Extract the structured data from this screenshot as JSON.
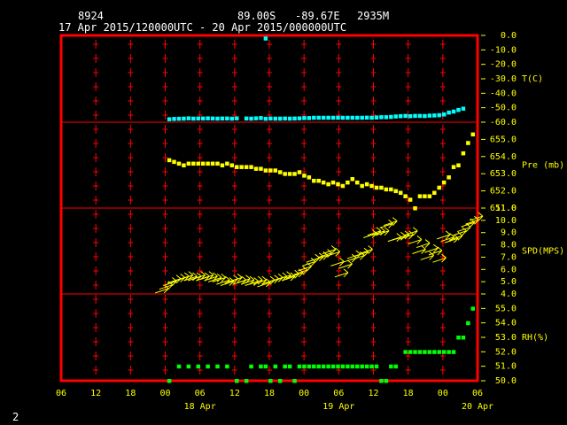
{
  "header": {
    "station": "8924",
    "lat": "89.00S",
    "lon": "-89.67E",
    "elev": "2935M",
    "time_range": "17 Apr 2015/120000UTC - 20 Apr 2015/000000UTC"
  },
  "page_number": "2",
  "colors": {
    "frame": "#ff0000",
    "grid": "#ff0000",
    "temp": "#00ffff",
    "pres": "#ffff00",
    "wind": "#ffff00",
    "rh": "#00ff00",
    "axis_text": "#ffff00",
    "header_text": "#ffffff"
  },
  "chart_data": {
    "type": "scatter",
    "x_axis": {
      "label": "",
      "units": "hours from 17 Apr 2015 06UTC",
      "xlim": [
        0,
        72
      ],
      "tick_hours": [
        0,
        6,
        12,
        18,
        24,
        30,
        36,
        42,
        48,
        54,
        60,
        66,
        72
      ],
      "tick_labels": [
        "06",
        "12",
        "18",
        "00",
        "06",
        "12",
        "18",
        "00",
        "06",
        "12",
        "18",
        "00",
        "06"
      ],
      "date_labels": [
        {
          "hour": 24,
          "text": "18 Apr"
        },
        {
          "hour": 48,
          "text": "19 Apr"
        },
        {
          "hour": 72,
          "text": "20 Apr"
        }
      ]
    },
    "panels": [
      {
        "name": "temp",
        "label": "T(C)",
        "ylim": [
          -60,
          0
        ],
        "ticks": [
          "0.0",
          "-10.0",
          "-20.0",
          "-30.0",
          "-40.0",
          "-50.0",
          "-60.0"
        ],
        "tick_values": [
          0,
          -10,
          -20,
          -30,
          -40,
          -50,
          -60
        ],
        "points": [
          [
            8,
            -57.8
          ],
          [
            9,
            -57.6
          ],
          [
            10,
            -57.5
          ],
          [
            11,
            -57.4
          ],
          [
            12,
            -57.2
          ],
          [
            13,
            -57.4
          ],
          [
            14,
            -57.3
          ],
          [
            15,
            -57.3
          ],
          [
            16,
            -57.2
          ],
          [
            17,
            -57.3
          ],
          [
            18,
            -57.4
          ],
          [
            19,
            -57.3
          ],
          [
            20,
            -57.3
          ],
          [
            21,
            -57.4
          ],
          [
            22,
            -57.2
          ],
          [
            24,
            -57.3
          ],
          [
            25,
            -57.4
          ],
          [
            26,
            -57.2
          ],
          [
            27,
            -57.0
          ],
          [
            28,
            -2.0
          ],
          [
            28,
            -57.5
          ],
          [
            29,
            -57.3
          ],
          [
            30,
            -57.4
          ],
          [
            31,
            -57.4
          ],
          [
            32,
            -57.3
          ],
          [
            33,
            -57.4
          ],
          [
            34,
            -57.3
          ],
          [
            35,
            -57.2
          ],
          [
            36,
            -57.0
          ],
          [
            37,
            -57.0
          ],
          [
            38,
            -56.8
          ],
          [
            39,
            -56.8
          ],
          [
            40,
            -56.8
          ],
          [
            41,
            -56.8
          ],
          [
            42,
            -56.8
          ],
          [
            43,
            -56.8
          ],
          [
            44,
            -56.8
          ],
          [
            45,
            -56.8
          ],
          [
            46,
            -56.8
          ],
          [
            47,
            -56.8
          ],
          [
            48,
            -56.8
          ],
          [
            49,
            -56.7
          ],
          [
            50,
            -56.8
          ],
          [
            51,
            -56.6
          ],
          [
            52,
            -56.4
          ],
          [
            53,
            -56.4
          ],
          [
            54,
            -56.2
          ],
          [
            55,
            -55.9
          ],
          [
            56,
            -55.7
          ],
          [
            57,
            -55.5
          ],
          [
            58,
            -55.7
          ],
          [
            59,
            -55.5
          ],
          [
            60,
            -55.5
          ],
          [
            61,
            -55.6
          ],
          [
            62,
            -55.3
          ],
          [
            63,
            -55.2
          ],
          [
            64,
            -55.0
          ],
          [
            65,
            -54.5
          ],
          [
            66,
            -53.2
          ],
          [
            67,
            -52.5
          ],
          [
            68,
            -51.4
          ],
          [
            69,
            -50.5
          ]
        ]
      },
      {
        "name": "pres",
        "label": "Pre (mb)",
        "ylim": [
          651,
          656
        ],
        "ticks": [
          "655.0",
          "654.0",
          "653.0",
          "652.0",
          "651.0"
        ],
        "tick_values": [
          655,
          654,
          653,
          652,
          651
        ],
        "points": [
          [
            8,
            653.8
          ],
          [
            9,
            653.7
          ],
          [
            10,
            653.6
          ],
          [
            11,
            653.5
          ],
          [
            12,
            653.6
          ],
          [
            13,
            653.6
          ],
          [
            14,
            653.6
          ],
          [
            15,
            653.6
          ],
          [
            16,
            653.6
          ],
          [
            17,
            653.6
          ],
          [
            18,
            653.6
          ],
          [
            19,
            653.5
          ],
          [
            20,
            653.6
          ],
          [
            21,
            653.5
          ],
          [
            22,
            653.4
          ],
          [
            23,
            653.4
          ],
          [
            24,
            653.4
          ],
          [
            25,
            653.4
          ],
          [
            26,
            653.3
          ],
          [
            27,
            653.3
          ],
          [
            28,
            653.2
          ],
          [
            29,
            653.2
          ],
          [
            30,
            653.2
          ],
          [
            31,
            653.1
          ],
          [
            32,
            653.0
          ],
          [
            33,
            653.0
          ],
          [
            34,
            653.0
          ],
          [
            35,
            653.1
          ],
          [
            36,
            652.9
          ],
          [
            37,
            652.8
          ],
          [
            38,
            652.6
          ],
          [
            39,
            652.6
          ],
          [
            40,
            652.5
          ],
          [
            41,
            652.4
          ],
          [
            42,
            652.5
          ],
          [
            43,
            652.4
          ],
          [
            44,
            652.3
          ],
          [
            45,
            652.5
          ],
          [
            46,
            652.7
          ],
          [
            47,
            652.5
          ],
          [
            48,
            652.3
          ],
          [
            49,
            652.4
          ],
          [
            50,
            652.3
          ],
          [
            51,
            652.2
          ],
          [
            52,
            652.2
          ],
          [
            53,
            652.1
          ],
          [
            54,
            652.1
          ],
          [
            55,
            652.0
          ],
          [
            56,
            651.9
          ],
          [
            57,
            651.7
          ],
          [
            58,
            651.5
          ],
          [
            59,
            651.0
          ],
          [
            60,
            651.7
          ],
          [
            61,
            651.7
          ],
          [
            62,
            651.7
          ],
          [
            63,
            651.9
          ],
          [
            64,
            652.2
          ],
          [
            65,
            652.5
          ],
          [
            66,
            652.8
          ],
          [
            67,
            653.4
          ],
          [
            68,
            653.5
          ],
          [
            69,
            654.2
          ],
          [
            70,
            654.8
          ],
          [
            71,
            655.3
          ]
        ]
      },
      {
        "name": "wind",
        "label": "SPD(MPS)",
        "ylim": [
          4,
          11
        ],
        "ticks": [
          "11.0",
          "10.0",
          "9.0",
          "8.0",
          "7.0",
          "6.0",
          "5.0",
          "4.0"
        ],
        "tick_values": [
          11,
          10,
          9,
          8,
          7,
          6,
          5,
          4
        ],
        "points": [
          [
            8,
            4.3
          ],
          [
            9,
            4.6
          ],
          [
            10,
            4.9
          ],
          [
            11,
            5.1
          ],
          [
            12,
            5.2
          ],
          [
            13,
            5.3
          ],
          [
            14,
            5.4
          ],
          [
            15,
            5.3
          ],
          [
            16,
            5.3
          ],
          [
            17,
            5.4
          ],
          [
            18,
            5.3
          ],
          [
            19,
            5.4
          ],
          [
            20,
            5.3
          ],
          [
            21,
            5.2
          ],
          [
            22,
            5.2
          ],
          [
            23,
            5.0
          ],
          [
            24,
            4.9
          ],
          [
            25,
            5.1
          ],
          [
            26,
            5.2
          ],
          [
            27,
            5.0
          ],
          [
            28,
            5.1
          ],
          [
            29,
            5.0
          ],
          [
            30,
            4.9
          ],
          [
            31,
            5.0
          ],
          [
            32,
            5.0
          ],
          [
            33,
            4.8
          ],
          [
            34,
            5.0
          ],
          [
            35,
            5.1
          ],
          [
            36,
            5.2
          ],
          [
            37,
            5.3
          ],
          [
            38,
            5.4
          ],
          [
            39,
            5.3
          ],
          [
            40,
            5.5
          ],
          [
            41,
            5.6
          ],
          [
            42,
            5.8
          ],
          [
            43,
            6.1
          ],
          [
            44,
            6.5
          ],
          [
            45,
            6.8
          ],
          [
            46,
            6.9
          ],
          [
            47,
            7.0
          ],
          [
            48,
            7.2
          ],
          [
            49,
            7.5
          ],
          [
            50,
            7.3
          ],
          [
            51,
            6.5
          ],
          [
            52,
            5.6
          ],
          [
            53,
            6.3
          ],
          [
            54,
            6.8
          ],
          [
            55,
            7.1
          ],
          [
            56,
            7.0
          ],
          [
            57,
            7.3
          ],
          [
            58,
            7.5
          ],
          [
            59,
            8.8
          ],
          [
            60,
            9.0
          ],
          [
            61,
            9.0
          ],
          [
            62,
            9.0
          ],
          [
            63,
            9.6
          ],
          [
            64,
            9.8
          ],
          [
            65,
            8.5
          ],
          [
            66,
            8.6
          ],
          [
            67,
            8.7
          ],
          [
            68,
            8.7
          ],
          [
            69,
            9.0
          ],
          [
            70,
            8.3
          ],
          [
            71,
            7.5
          ],
          [
            72,
            8.0
          ],
          [
            73,
            7.0
          ],
          [
            74,
            7.6
          ],
          [
            75,
            7.4
          ],
          [
            76,
            6.8
          ],
          [
            77,
            8.7
          ],
          [
            78,
            8.5
          ],
          [
            79,
            8.4
          ],
          [
            80,
            8.6
          ],
          [
            81,
            9.0
          ],
          [
            82,
            9.3
          ],
          [
            83,
            9.7
          ],
          [
            84,
            9.9
          ],
          [
            85,
            10.2
          ]
        ]
      },
      {
        "name": "rh",
        "label": "RH(%)",
        "ylim": [
          50,
          56
        ],
        "ticks": [
          "55.0",
          "54.0",
          "53.0",
          "52.0",
          "51.0",
          "50.0"
        ],
        "tick_values": [
          55,
          54,
          53,
          52,
          51,
          50
        ],
        "points": [
          [
            8,
            50.0
          ],
          [
            10,
            51.0
          ],
          [
            12,
            51.0
          ],
          [
            14,
            51.0
          ],
          [
            16,
            51.0
          ],
          [
            18,
            51.0
          ],
          [
            20,
            51.0
          ],
          [
            22,
            50.0
          ],
          [
            24,
            50.0
          ],
          [
            25,
            51.0
          ],
          [
            27,
            51.0
          ],
          [
            28,
            51.0
          ],
          [
            29,
            50.0
          ],
          [
            30,
            51.0
          ],
          [
            31,
            50.0
          ],
          [
            32,
            51.0
          ],
          [
            33,
            51.0
          ],
          [
            34,
            50.0
          ],
          [
            35,
            51.0
          ],
          [
            36,
            51.0
          ],
          [
            37,
            51.0
          ],
          [
            38,
            51.0
          ],
          [
            39,
            51.0
          ],
          [
            40,
            51.0
          ],
          [
            41,
            51.0
          ],
          [
            42,
            51.0
          ],
          [
            43,
            51.0
          ],
          [
            44,
            51.0
          ],
          [
            45,
            51.0
          ],
          [
            46,
            51.0
          ],
          [
            47,
            51.0
          ],
          [
            48,
            51.0
          ],
          [
            49,
            51.0
          ],
          [
            50,
            51.0
          ],
          [
            51,
            51.0
          ],
          [
            52,
            50.0
          ],
          [
            53,
            50.0
          ],
          [
            54,
            51.0
          ],
          [
            55,
            51.0
          ],
          [
            57,
            52.0
          ],
          [
            58,
            52.0
          ],
          [
            59,
            52.0
          ],
          [
            60,
            52.0
          ],
          [
            61,
            52.0
          ],
          [
            62,
            52.0
          ],
          [
            63,
            52.0
          ],
          [
            64,
            52.0
          ],
          [
            65,
            52.0
          ],
          [
            66,
            52.0
          ],
          [
            67,
            52.0
          ],
          [
            68,
            53.0
          ],
          [
            69,
            53.0
          ],
          [
            70,
            54.0
          ],
          [
            71,
            55.0
          ]
        ]
      }
    ]
  }
}
